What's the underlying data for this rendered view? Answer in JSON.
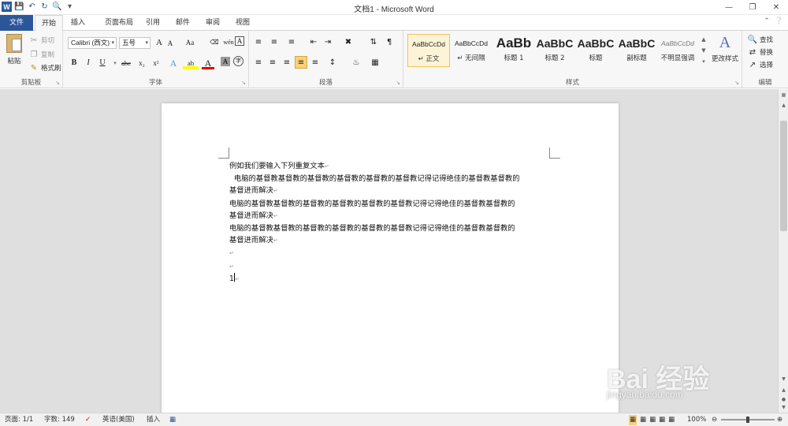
{
  "window": {
    "title": "文档1 - Microsoft Word"
  },
  "quick_access": {
    "logo": "W",
    "icons": [
      "save-icon",
      "undo-icon",
      "redo-icon",
      "print-preview-icon",
      "customize-icon"
    ]
  },
  "tabs": [
    {
      "label": "文件",
      "active": false,
      "is_file": true
    },
    {
      "label": "开始",
      "active": true
    },
    {
      "label": "插入",
      "active": false
    },
    {
      "label": "页面布局",
      "active": false
    },
    {
      "label": "引用",
      "active": false
    },
    {
      "label": "邮件",
      "active": false
    },
    {
      "label": "审阅",
      "active": false
    },
    {
      "label": "视图",
      "active": false
    }
  ],
  "ribbon": {
    "clipboard": {
      "label": "剪贴板",
      "paste": "粘贴",
      "cut": "剪切",
      "copy": "复制",
      "format_painter": "格式刷"
    },
    "font": {
      "label": "字体",
      "font_name": "Calibri (西文)",
      "font_size": "五号",
      "change_case": "Aa",
      "bold": "B",
      "italic": "I",
      "underline": "U",
      "strike": "abc",
      "subscript": "x₂",
      "superscript": "x²",
      "grow": "A",
      "shrink": "A",
      "phonetic": "wén",
      "char_border": "A",
      "text_effect": "A",
      "highlight": "ab",
      "font_color": "A",
      "char_shading": "A",
      "enclose": "字"
    },
    "paragraph": {
      "label": "段落"
    },
    "styles": {
      "label": "样式",
      "items": [
        {
          "sample": "AaBbCcDd",
          "name": "↵ 正文",
          "selected": true,
          "size": "8.5px",
          "weight": "normal"
        },
        {
          "sample": "AaBbCcDd",
          "name": "↵ 无间隔",
          "selected": false,
          "size": "8.5px",
          "weight": "normal"
        },
        {
          "sample": "AaBb",
          "name": "标题 1",
          "selected": false,
          "size": "17px",
          "weight": "bold"
        },
        {
          "sample": "AaBbC",
          "name": "标题 2",
          "selected": false,
          "size": "14px",
          "weight": "bold"
        },
        {
          "sample": "AaBbC",
          "name": "标题",
          "selected": false,
          "size": "14px",
          "weight": "bold"
        },
        {
          "sample": "AaBbC",
          "name": "副标题",
          "selected": false,
          "size": "14px",
          "weight": "bold"
        },
        {
          "sample": "AaBbCcDd",
          "name": "不明显强调",
          "selected": false,
          "size": "8.5px",
          "weight": "normal",
          "italic": true
        }
      ],
      "change_styles": "更改样式"
    },
    "editing": {
      "label": "编辑",
      "find": "查找",
      "replace": "替换",
      "select": "选择"
    }
  },
  "document": {
    "lines": [
      "例如我们要输入下列重复文本",
      "  电脑的基督教基督教的基督教的基督教的基督教的基督教记得记得绝佳的基督教基督教的",
      "基督进而解决",
      "电脑的基督教基督教的基督教的基督教的基督教的基督教记得记得绝佳的基督教基督教的",
      "基督进而解决",
      "电脑的基督教基督教的基督教的基督教的基督教的基督教记得记得绝佳的基督教基督教的",
      "基督进而解决",
      "",
      "",
      "1"
    ]
  },
  "statusbar": {
    "page": "页面: 1/1",
    "words": "字数: 149",
    "language": "英语(美国)",
    "mode": "插入",
    "zoom": "100%"
  },
  "watermark": {
    "brand": "Bai 经验",
    "url": "jingyan.baidu.com"
  }
}
